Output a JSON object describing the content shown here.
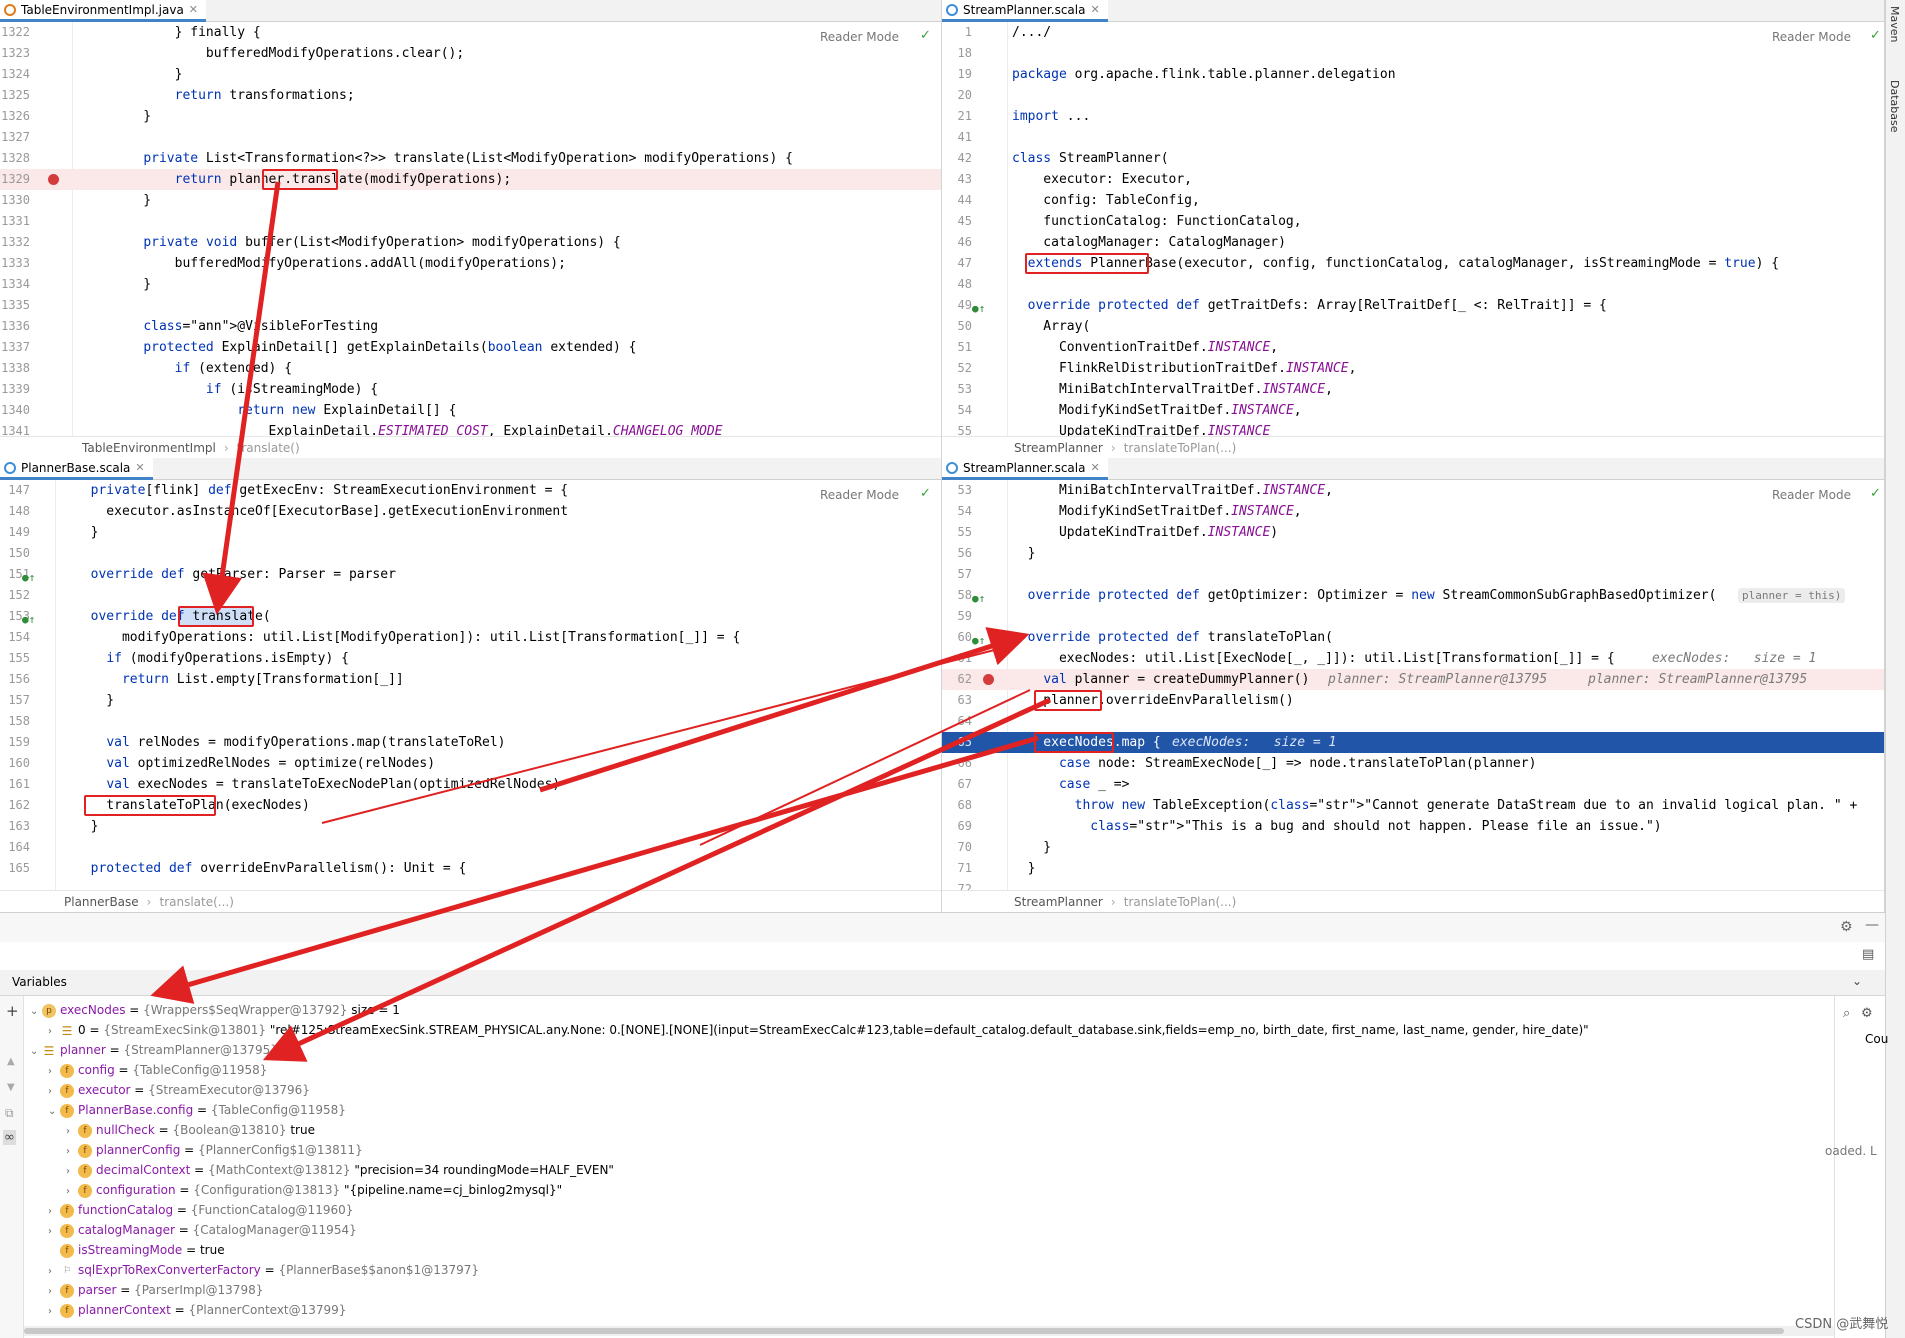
{
  "panes": {
    "tl": {
      "tab": "TableEnvironmentImpl.java",
      "reader_mode": "Reader Mode",
      "breadcrumb": [
        "TableEnvironmentImpl",
        "translate()"
      ],
      "lines": [
        {
          "n": "1322",
          "t": "        } finally {"
        },
        {
          "n": "1323",
          "t": "            bufferedModifyOperations.clear();"
        },
        {
          "n": "1324",
          "t": "        }"
        },
        {
          "n": "1325",
          "t": "        return transformations;"
        },
        {
          "n": "1326",
          "t": "    }"
        },
        {
          "n": "1327",
          "t": ""
        },
        {
          "n": "1328",
          "t": "    private List<Transformation<?>> translate(List<ModifyOperation> modifyOperations) {"
        },
        {
          "n": "1329",
          "t": "        return planner.translate(modifyOperations);"
        },
        {
          "n": "1330",
          "t": "    }"
        },
        {
          "n": "1331",
          "t": ""
        },
        {
          "n": "1332",
          "t": "    private void buffer(List<ModifyOperation> modifyOperations) {"
        },
        {
          "n": "1333",
          "t": "        bufferedModifyOperations.addAll(modifyOperations);"
        },
        {
          "n": "1334",
          "t": "    }"
        },
        {
          "n": "1335",
          "t": ""
        },
        {
          "n": "1336",
          "t": "    @VisibleForTesting"
        },
        {
          "n": "1337",
          "t": "    protected ExplainDetail[] getExplainDetails(boolean extended) {"
        },
        {
          "n": "1338",
          "t": "        if (extended) {"
        },
        {
          "n": "1339",
          "t": "            if (isStreamingMode) {"
        },
        {
          "n": "1340",
          "t": "                return new ExplainDetail[] {"
        },
        {
          "n": "1341",
          "t": "                    ExplainDetail.ESTIMATED_COST, ExplainDetail.CHANGELOG_MODE"
        }
      ]
    },
    "tr": {
      "tab": "StreamPlanner.scala",
      "reader_mode": "Reader Mode",
      "breadcrumb": [
        "StreamPlanner",
        "translateToPlan(...)"
      ],
      "lines": [
        {
          "n": "1",
          "t": "/.../"
        },
        {
          "n": "18",
          "t": ""
        },
        {
          "n": "19",
          "t": "package org.apache.flink.table.planner.delegation"
        },
        {
          "n": "20",
          "t": ""
        },
        {
          "n": "21",
          "t": "import ..."
        },
        {
          "n": "41",
          "t": ""
        },
        {
          "n": "42",
          "t": "class StreamPlanner("
        },
        {
          "n": "43",
          "t": "    executor: Executor,"
        },
        {
          "n": "44",
          "t": "    config: TableConfig,"
        },
        {
          "n": "45",
          "t": "    functionCatalog: FunctionCatalog,"
        },
        {
          "n": "46",
          "t": "    catalogManager: CatalogManager)"
        },
        {
          "n": "47",
          "t": "  extends PlannerBase(executor, config, functionCatalog, catalogManager, isStreamingMode = true) {"
        },
        {
          "n": "48",
          "t": ""
        },
        {
          "n": "49",
          "t": "  override protected def getTraitDefs: Array[RelTraitDef[_ <: RelTrait]] = {"
        },
        {
          "n": "50",
          "t": "    Array("
        },
        {
          "n": "51",
          "t": "      ConventionTraitDef.INSTANCE,"
        },
        {
          "n": "52",
          "t": "      FlinkRelDistributionTraitDef.INSTANCE,"
        },
        {
          "n": "53",
          "t": "      MiniBatchIntervalTraitDef.INSTANCE,"
        },
        {
          "n": "54",
          "t": "      ModifyKindSetTraitDef.INSTANCE,"
        },
        {
          "n": "55",
          "t": "      UpdateKindTraitDef.INSTANCE"
        }
      ]
    },
    "bl": {
      "tab": "PlannerBase.scala",
      "reader_mode": "Reader Mode",
      "breadcrumb": [
        "PlannerBase",
        "translate(...)"
      ],
      "lines": [
        {
          "n": "147",
          "t": "  private[flink] def getExecEnv: StreamExecutionEnvironment = {"
        },
        {
          "n": "148",
          "t": "    executor.asInstanceOf[ExecutorBase].getExecutionEnvironment"
        },
        {
          "n": "149",
          "t": "  }"
        },
        {
          "n": "150",
          "t": ""
        },
        {
          "n": "151",
          "t": "  override def getParser: Parser = parser"
        },
        {
          "n": "152",
          "t": ""
        },
        {
          "n": "153",
          "t": "  override def translate("
        },
        {
          "n": "154",
          "t": "      modifyOperations: util.List[ModifyOperation]): util.List[Transformation[_]] = {"
        },
        {
          "n": "155",
          "t": "    if (modifyOperations.isEmpty) {"
        },
        {
          "n": "156",
          "t": "      return List.empty[Transformation[_]]"
        },
        {
          "n": "157",
          "t": "    }"
        },
        {
          "n": "158",
          "t": ""
        },
        {
          "n": "159",
          "t": "    val relNodes = modifyOperations.map(translateToRel)"
        },
        {
          "n": "160",
          "t": "    val optimizedRelNodes = optimize(relNodes)"
        },
        {
          "n": "161",
          "t": "    val execNodes = translateToExecNodePlan(optimizedRelNodes)"
        },
        {
          "n": "162",
          "t": "    translateToPlan(execNodes)"
        },
        {
          "n": "163",
          "t": "  }"
        },
        {
          "n": "164",
          "t": ""
        },
        {
          "n": "165",
          "t": "  protected def overrideEnvParallelism(): Unit = {"
        }
      ]
    },
    "br": {
      "tab": "StreamPlanner.scala",
      "reader_mode": "Reader Mode",
      "breadcrumb": [
        "StreamPlanner",
        "translateToPlan(...)"
      ],
      "lines": [
        {
          "n": "53",
          "t": "      MiniBatchIntervalTraitDef.INSTANCE,"
        },
        {
          "n": "54",
          "t": "      ModifyKindSetTraitDef.INSTANCE,"
        },
        {
          "n": "55",
          "t": "      UpdateKindTraitDef.INSTANCE)"
        },
        {
          "n": "56",
          "t": "  }"
        },
        {
          "n": "57",
          "t": ""
        },
        {
          "n": "58",
          "t": "  override protected def getOptimizer: Optimizer = new StreamCommonSubGraphBasedOptimizer("
        },
        {
          "n": "59",
          "t": ""
        },
        {
          "n": "60",
          "t": "  override protected def translateToPlan("
        },
        {
          "n": "61",
          "t": "      execNodes: util.List[ExecNode[_, _]]): util.List[Transformation[_]] = {"
        },
        {
          "n": "62",
          "t": "    val planner = createDummyPlanner()"
        },
        {
          "n": "63",
          "t": "    planner.overrideEnvParallelism()"
        },
        {
          "n": "64",
          "t": ""
        },
        {
          "n": "65",
          "t": "    execNodes.map {"
        },
        {
          "n": "66",
          "t": "      case node: StreamExecNode[_] => node.translateToPlan(planner)"
        },
        {
          "n": "67",
          "t": "      case _ =>"
        },
        {
          "n": "68",
          "t": "        throw new TableException(\"Cannot generate DataStream due to an invalid logical plan. \" +"
        },
        {
          "n": "69",
          "t": "          \"This is a bug and should not happen. Please file an issue.\")"
        },
        {
          "n": "70",
          "t": "    }"
        },
        {
          "n": "71",
          "t": "  }"
        },
        {
          "n": "72",
          "t": ""
        }
      ],
      "hints": {
        "optimizer_param": "planner = this)",
        "l61": "execNodes:   size = 1",
        "l62a": "planner: StreamPlanner@13795",
        "l62b": "planner: StreamPlanner@13795",
        "l65": "execNodes:   size = 1"
      }
    }
  },
  "side_tabs": [
    "Maven",
    "Database"
  ],
  "variables": {
    "header": "Variables",
    "side_text": [
      "Cou",
      "oaded. L"
    ],
    "rows": [
      {
        "level": 0,
        "expanded": true,
        "icon": "p",
        "name": "execNodes",
        "ref": "{Wrappers$SeqWrapper@13792}",
        "val": "size = 1"
      },
      {
        "level": 1,
        "expanded": false,
        "icon": "list",
        "name": "0",
        "ref": "{StreamExecSink@13801}",
        "val": "\"rel#125:StreamExecSink.STREAM_PHYSICAL.any.None: 0.[NONE].[NONE](input=StreamExecCalc#123,table=default_catalog.default_database.sink,fields=emp_no, birth_date, first_name, last_name, gender, hire_date)\""
      },
      {
        "level": 0,
        "expanded": true,
        "icon": "list",
        "name": "planner",
        "ref": "{StreamPlanner@13795}",
        "val": ""
      },
      {
        "level": 1,
        "expanded": false,
        "icon": "f",
        "name": "config",
        "ref": "{TableConfig@11958}",
        "val": ""
      },
      {
        "level": 1,
        "expanded": false,
        "icon": "f",
        "name": "executor",
        "ref": "{StreamExecutor@13796}",
        "val": ""
      },
      {
        "level": 1,
        "expanded": true,
        "icon": "f",
        "name": "PlannerBase.config",
        "ref": "{TableConfig@11958}",
        "val": ""
      },
      {
        "level": 2,
        "expanded": false,
        "icon": "f",
        "name": "nullCheck",
        "ref": "{Boolean@13810}",
        "val": "true"
      },
      {
        "level": 2,
        "expanded": false,
        "icon": "f",
        "name": "plannerConfig",
        "ref": "{PlannerConfig$1@13811}",
        "val": ""
      },
      {
        "level": 2,
        "expanded": false,
        "icon": "f",
        "name": "decimalContext",
        "ref": "{MathContext@13812}",
        "val": "\"precision=34 roundingMode=HALF_EVEN\""
      },
      {
        "level": 2,
        "expanded": false,
        "icon": "f",
        "name": "configuration",
        "ref": "{Configuration@13813}",
        "val": "\"{pipeline.name=cj_binlog2mysql}\""
      },
      {
        "level": 1,
        "expanded": false,
        "icon": "f",
        "name": "functionCatalog",
        "ref": "{FunctionCatalog@11960}",
        "val": ""
      },
      {
        "level": 1,
        "expanded": false,
        "icon": "f",
        "name": "catalogManager",
        "ref": "{CatalogManager@11954}",
        "val": ""
      },
      {
        "level": 1,
        "expanded": null,
        "icon": "f",
        "name": "isStreamingMode",
        "ref": "",
        "val": "true"
      },
      {
        "level": 1,
        "expanded": false,
        "icon": "flag",
        "name": "sqlExprToRexConverterFactory",
        "ref": "{PlannerBase$$anon$1@13797}",
        "val": ""
      },
      {
        "level": 1,
        "expanded": false,
        "icon": "f",
        "name": "parser",
        "ref": "{ParserImpl@13798}",
        "val": ""
      },
      {
        "level": 1,
        "expanded": false,
        "icon": "f",
        "name": "plannerContext",
        "ref": "{PlannerContext@13799}",
        "val": ""
      }
    ]
  },
  "watermark": "CSDN @武舞悦"
}
